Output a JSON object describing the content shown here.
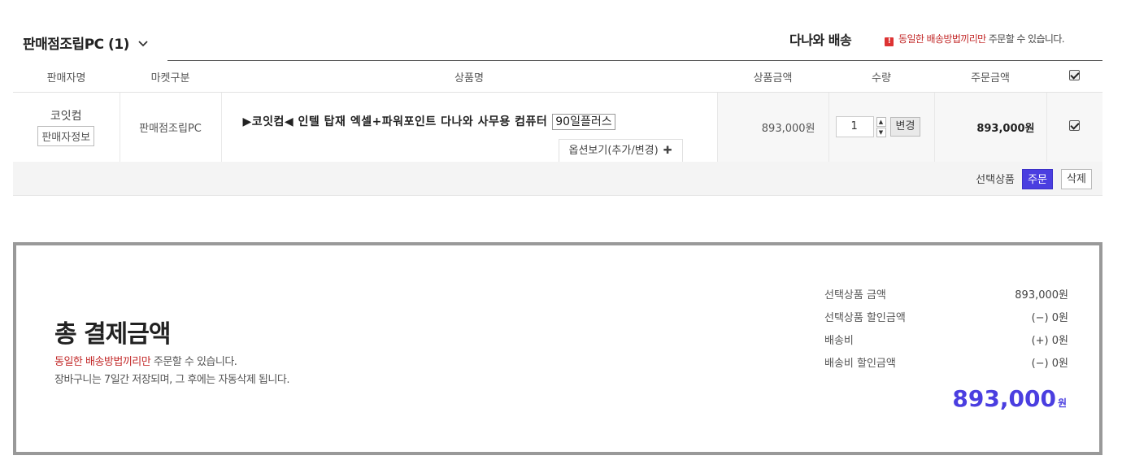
{
  "cart_header": {
    "seller_group": "판매점조립PC (1)",
    "shipping_title": "다나와 배송",
    "notice_warn_icon": "!",
    "notice_highlight": "동일한 배송방법끼리만",
    "notice_rest": " 주문할 수 있습니다."
  },
  "table": {
    "headers": [
      "판매자명",
      "마켓구분",
      "상품명",
      "상품금액",
      "수량",
      "주문금액"
    ],
    "rows": [
      {
        "seller": "코잇컴",
        "seller_info_button": "판매자정보",
        "market": "판매점조립PC",
        "product_name": "▶코잇컴◀ 인텔 탑재 엑셀+파워포인트 다나와 사무용 컴퓨터",
        "product_tag": "90일플러스",
        "option_button": "옵션보기(추가/변경)",
        "price": "893,000원",
        "quantity": "1",
        "change_button": "변경",
        "order_total": "893,000원",
        "checked": true
      }
    ],
    "select_all_checked": true
  },
  "actions": {
    "selected_label": "선택상품",
    "order_button": "주문",
    "delete_button": "삭제"
  },
  "summary": {
    "title": "총 결제금액",
    "note_highlight": "동일한 배송방법끼리만",
    "note_rest": " 주문할 수 있습니다.",
    "note2": "장바구니는 7일간 저장되며, 그 후에는 자동삭제 됩니다.",
    "rows": [
      {
        "label": "선택상품 금액",
        "value": "893,000원"
      },
      {
        "label": "선택상품 할인금액",
        "value": "(−) 0원"
      },
      {
        "label": "배송비",
        "value": "(+) 0원"
      },
      {
        "label": "배송비 할인금액",
        "value": "(−) 0원"
      }
    ],
    "grand_total": "893,000",
    "grand_unit": "원"
  },
  "colors": {
    "accent": "#4a3ee0",
    "warning": "#c32a2a",
    "warn_icon_bg": "#dd3333"
  }
}
